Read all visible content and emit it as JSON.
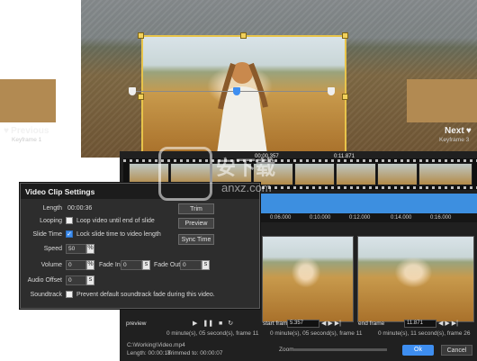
{
  "nav": {
    "previous": {
      "label": "Previous",
      "sub": "Keyframe 1"
    },
    "next": {
      "label": "Next",
      "sub": "Keyframe 3"
    }
  },
  "timeline": {
    "marker_left": "00:00.357",
    "marker_right": "0:11.871",
    "ruler": [
      "0:06.000",
      "0:10.000",
      "0:12.000",
      "0:14.000",
      "0:16.000"
    ]
  },
  "previews": {
    "preview": {
      "label": "preview",
      "info": "0 minute(s), 05 second(s), frame 11"
    },
    "start": {
      "label": "start frame",
      "value": "5.357",
      "info": "0 minute(s), 05 second(s), frame 11"
    },
    "end": {
      "label": "end frame",
      "value": "11.871",
      "info": "0 minute(s), 11 second(s), frame 26"
    }
  },
  "footer": {
    "file": "C:\\Working\\Video.mp4",
    "length_text": "Length: 00:00:18",
    "trimmed_text": "Trimmed to: 00:00:07",
    "zoom_label": "Zoom",
    "ok": "Ok",
    "cancel": "Cancel"
  },
  "dialog": {
    "title": "Video Clip Settings",
    "length_label": "Length",
    "length_value": "00:00:36",
    "trim": "Trim",
    "looping_label": "Looping",
    "looping_text": "Loop video until end of slide",
    "preview": "Preview",
    "slide_time_label": "Slide Time",
    "slide_time_text": "Lock slide time to video length",
    "sync_time": "Sync Time",
    "speed_label": "Speed",
    "speed_value": "50",
    "volume_label": "Volume",
    "volume_value": "0",
    "fade_in_label": "Fade In",
    "fade_in_value": "0",
    "fade_out_label": "Fade Out",
    "fade_out_value": "0",
    "audio_offset_label": "Audio Offset",
    "audio_offset_value": "0",
    "soundtrack_label": "Soundtrack",
    "soundtrack_text": "Prevent default soundtrack fade during this video.",
    "percent": "%",
    "seconds": "s",
    "looping_checked": false,
    "slide_time_checked": true,
    "soundtrack_checked": false
  },
  "watermark": {
    "text": "安下载",
    "sub": "anxz.com"
  },
  "colors": {
    "accent": "#3e8ef0",
    "gold": "#e8c44a"
  },
  "icons": [
    "play-icon",
    "pause-icon",
    "stop-icon",
    "loop-icon",
    "step-back-icon",
    "step-forward-icon",
    "keyframe-icon",
    "check-icon"
  ]
}
